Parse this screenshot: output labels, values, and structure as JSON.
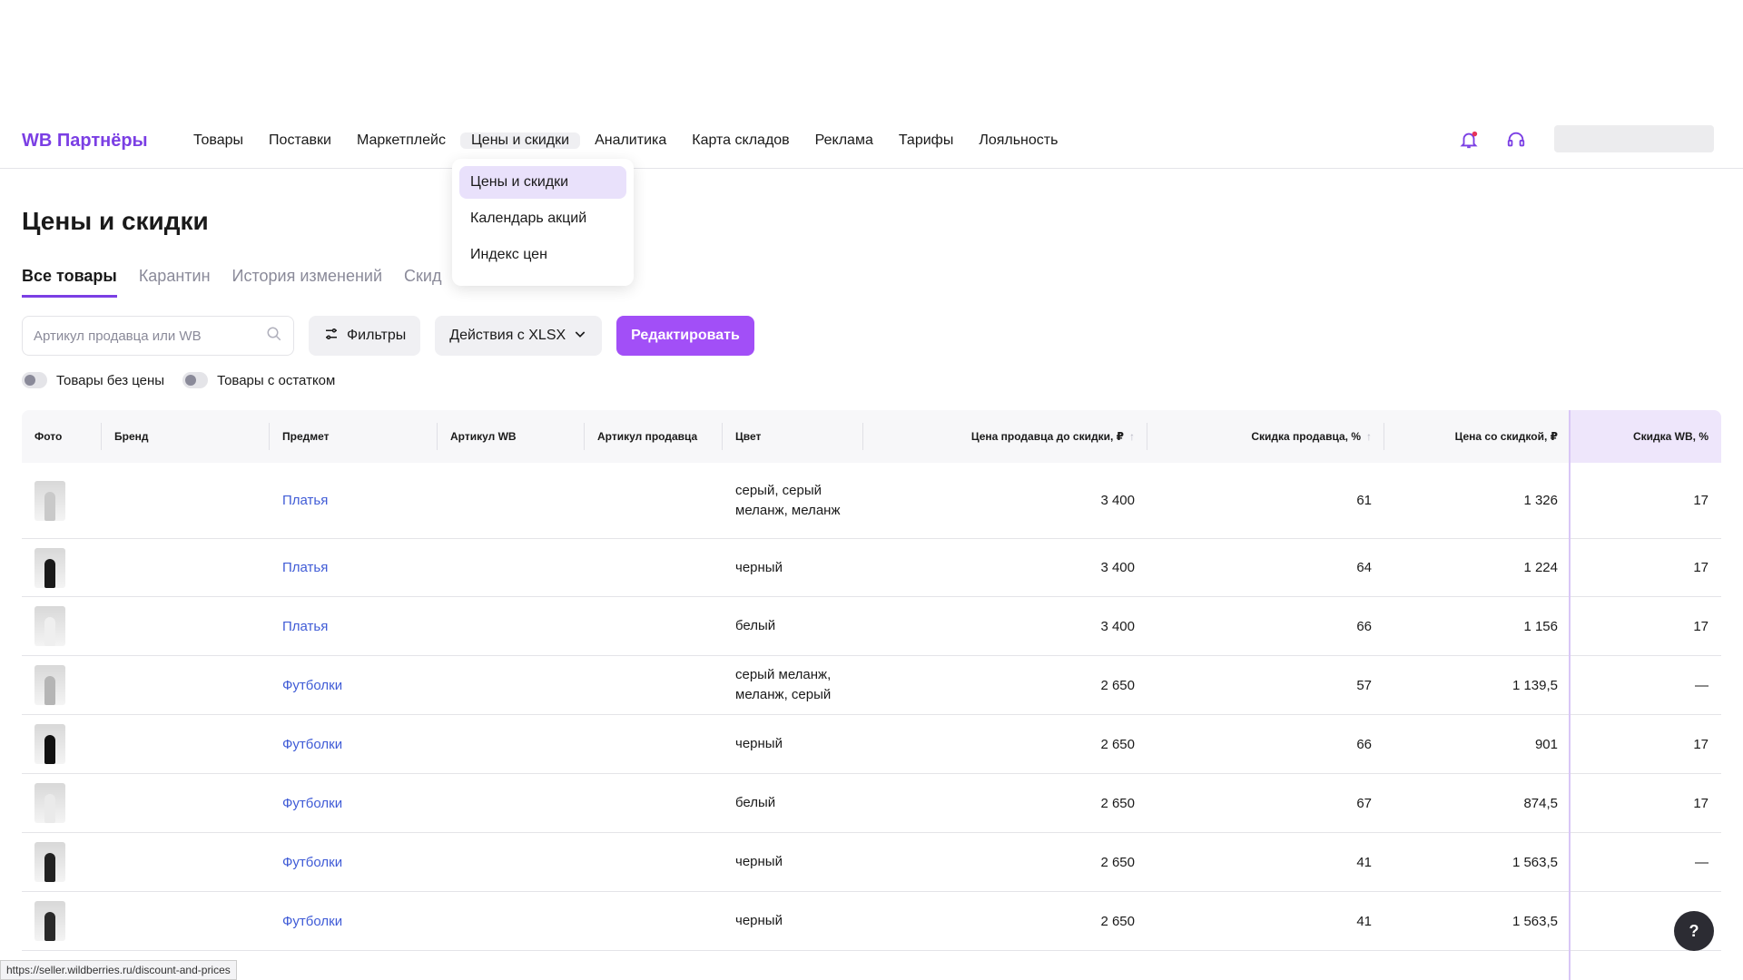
{
  "nav": {
    "logo": "WB Партнёры",
    "links": [
      "Товары",
      "Поставки",
      "Маркетплейс",
      "Цены и скидки",
      "Аналитика",
      "Карта складов",
      "Реклама",
      "Тарифы",
      "Лояльность"
    ],
    "active": "Цены и скидки"
  },
  "dropdown": {
    "items": [
      "Цены и скидки",
      "Календарь акций",
      "Индекс цен"
    ],
    "active": "Цены и скидки"
  },
  "page": {
    "title": "Цены и скидки"
  },
  "tabs": [
    "Все товары",
    "Карантин",
    "История изменений",
    "Скид"
  ],
  "toolbar": {
    "search_placeholder": "Артикул продавца или WB",
    "filters_label": "Фильтры",
    "xlsx_label": "Действия с XLSX",
    "edit_label": "Редактировать"
  },
  "toggles": [
    "Товары без цены",
    "Товары с остатком"
  ],
  "table": {
    "headers": [
      "Фото",
      "Бренд",
      "Предмет",
      "Артикул WB",
      "Артикул продавца",
      "Цвет",
      "Цена продавца до скидки, ₽",
      "Скидка продавца, %",
      "Цена со скидкой, ₽",
      "Скидка WB, %"
    ],
    "rows": [
      {
        "subject": "Платья",
        "color": "серый, серый меланж, меланж",
        "price": "3 400",
        "discount": "61",
        "final": "1 326",
        "wb": "17",
        "thumb": "#c9c9c9"
      },
      {
        "subject": "Платья",
        "color": "черный",
        "price": "3 400",
        "discount": "64",
        "final": "1 224",
        "wb": "17",
        "thumb": "#1a1a1a"
      },
      {
        "subject": "Платья",
        "color": "белый",
        "price": "3 400",
        "discount": "66",
        "final": "1 156",
        "wb": "17",
        "thumb": "#efefef"
      },
      {
        "subject": "Футболки",
        "color": "серый меланж, меланж, серый",
        "price": "2 650",
        "discount": "57",
        "final": "1 139,5",
        "wb": "—",
        "thumb": "#b5b5b5"
      },
      {
        "subject": "Футболки",
        "color": "черный",
        "price": "2 650",
        "discount": "66",
        "final": "901",
        "wb": "17",
        "thumb": "#111111"
      },
      {
        "subject": "Футболки",
        "color": "белый",
        "price": "2 650",
        "discount": "67",
        "final": "874,5",
        "wb": "17",
        "thumb": "#eaeaea"
      },
      {
        "subject": "Футболки",
        "color": "черный",
        "price": "2 650",
        "discount": "41",
        "final": "1 563,5",
        "wb": "—",
        "thumb": "#222222"
      },
      {
        "subject": "Футболки",
        "color": "черный",
        "price": "2 650",
        "discount": "41",
        "final": "1 563,5",
        "wb": "",
        "thumb": "#2a2a2a"
      }
    ]
  },
  "status_url": "https://seller.wildberries.ru/discount-and-prices",
  "help_label": "?",
  "colors": {
    "accent": "#7b3fe4",
    "primary_button": "#a24ff7",
    "link": "#3f5bd6"
  }
}
